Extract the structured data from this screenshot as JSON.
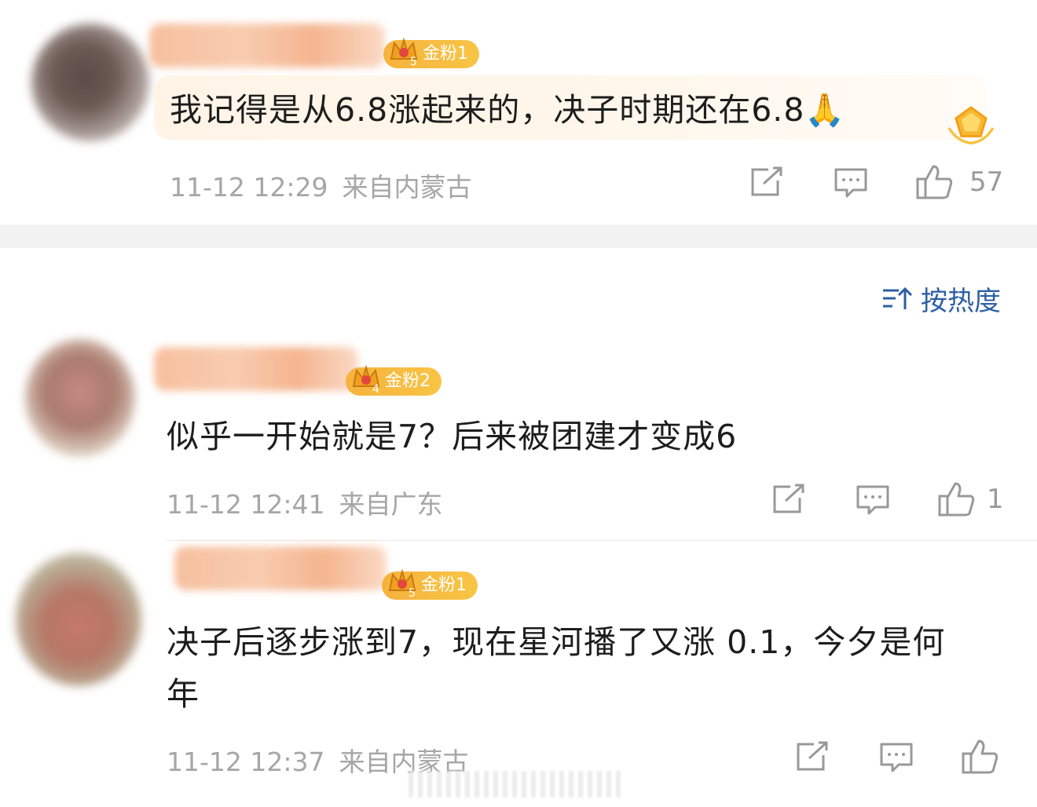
{
  "comments": [
    {
      "badge_label": "金粉1",
      "badge_level": "5",
      "text": "我记得是从6.8涨起来的，决子时期还在6.8🙏",
      "time": "11-12 12:29",
      "location": "来自内蒙古",
      "likes": "57"
    },
    {
      "badge_label": "金粉2",
      "badge_level": "4",
      "text": "似乎一开始就是7？后来被团建才变成6",
      "time": "11-12 12:41",
      "location": "来自广东",
      "likes": "1"
    },
    {
      "badge_label": "金粉1",
      "badge_level": "5",
      "text_line1": "决子后逐步涨到7，现在星河播了又涨 0.1，今夕是何",
      "text_line2": "年",
      "time": "11-12 12:37",
      "location": "来自内蒙古",
      "likes": ""
    }
  ],
  "sort": {
    "label": "按热度"
  },
  "icons": [
    "share-icon",
    "reply-icon",
    "like-icon",
    "sort-icon",
    "crown-icon",
    "medal-icon"
  ],
  "colors": {
    "accent": "#2d5fa3",
    "badge": "#f6b23d",
    "meta": "#a6a6a6"
  }
}
